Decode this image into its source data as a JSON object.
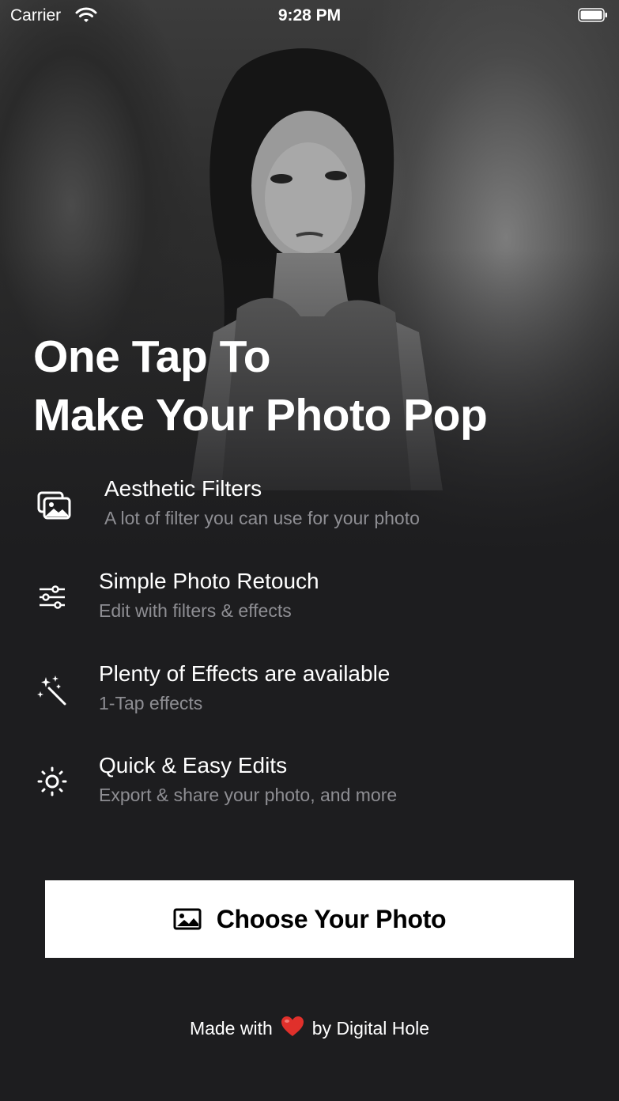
{
  "status_bar": {
    "carrier": "Carrier",
    "time": "9:28 PM"
  },
  "hero": {
    "headline_line1": "One Tap To",
    "headline_line2": "Make Your Photo Pop"
  },
  "features": [
    {
      "icon": "photos-icon",
      "title": "Aesthetic Filters",
      "subtitle": "A lot of filter you can use for your photo"
    },
    {
      "icon": "sliders-icon",
      "title": "Simple Photo Retouch",
      "subtitle": "Edit with filters & effects"
    },
    {
      "icon": "magic-wand-icon",
      "title": "Plenty of Effects are available",
      "subtitle": "1-Tap effects"
    },
    {
      "icon": "sun-icon",
      "title": "Quick & Easy Edits",
      "subtitle": "Export & share your photo, and more"
    }
  ],
  "cta": {
    "icon": "photo-icon",
    "label": "Choose Your Photo"
  },
  "footer": {
    "prefix": "Made with",
    "heart": "❤️",
    "suffix": "by Digital Hole"
  },
  "colors": {
    "background": "#1d1d1f",
    "subtitle": "#8e8e93",
    "button_bg": "#ffffff",
    "heart": "#e0302b"
  }
}
